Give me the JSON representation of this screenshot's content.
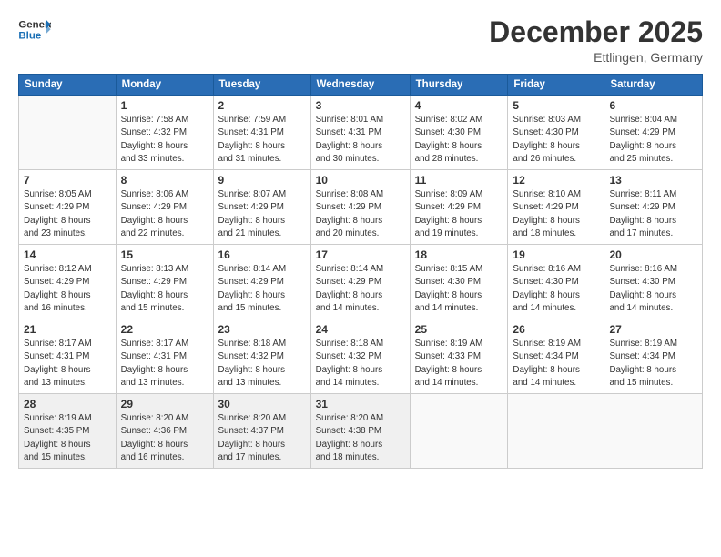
{
  "header": {
    "logo_line1": "General",
    "logo_line2": "Blue",
    "month_title": "December 2025",
    "location": "Ettlingen, Germany"
  },
  "days_of_week": [
    "Sunday",
    "Monday",
    "Tuesday",
    "Wednesday",
    "Thursday",
    "Friday",
    "Saturday"
  ],
  "weeks": [
    [
      {
        "day": "",
        "info": ""
      },
      {
        "day": "1",
        "info": "Sunrise: 7:58 AM\nSunset: 4:32 PM\nDaylight: 8 hours\nand 33 minutes."
      },
      {
        "day": "2",
        "info": "Sunrise: 7:59 AM\nSunset: 4:31 PM\nDaylight: 8 hours\nand 31 minutes."
      },
      {
        "day": "3",
        "info": "Sunrise: 8:01 AM\nSunset: 4:31 PM\nDaylight: 8 hours\nand 30 minutes."
      },
      {
        "day": "4",
        "info": "Sunrise: 8:02 AM\nSunset: 4:30 PM\nDaylight: 8 hours\nand 28 minutes."
      },
      {
        "day": "5",
        "info": "Sunrise: 8:03 AM\nSunset: 4:30 PM\nDaylight: 8 hours\nand 26 minutes."
      },
      {
        "day": "6",
        "info": "Sunrise: 8:04 AM\nSunset: 4:29 PM\nDaylight: 8 hours\nand 25 minutes."
      }
    ],
    [
      {
        "day": "7",
        "info": "Sunrise: 8:05 AM\nSunset: 4:29 PM\nDaylight: 8 hours\nand 23 minutes."
      },
      {
        "day": "8",
        "info": "Sunrise: 8:06 AM\nSunset: 4:29 PM\nDaylight: 8 hours\nand 22 minutes."
      },
      {
        "day": "9",
        "info": "Sunrise: 8:07 AM\nSunset: 4:29 PM\nDaylight: 8 hours\nand 21 minutes."
      },
      {
        "day": "10",
        "info": "Sunrise: 8:08 AM\nSunset: 4:29 PM\nDaylight: 8 hours\nand 20 minutes."
      },
      {
        "day": "11",
        "info": "Sunrise: 8:09 AM\nSunset: 4:29 PM\nDaylight: 8 hours\nand 19 minutes."
      },
      {
        "day": "12",
        "info": "Sunrise: 8:10 AM\nSunset: 4:29 PM\nDaylight: 8 hours\nand 18 minutes."
      },
      {
        "day": "13",
        "info": "Sunrise: 8:11 AM\nSunset: 4:29 PM\nDaylight: 8 hours\nand 17 minutes."
      }
    ],
    [
      {
        "day": "14",
        "info": "Sunrise: 8:12 AM\nSunset: 4:29 PM\nDaylight: 8 hours\nand 16 minutes."
      },
      {
        "day": "15",
        "info": "Sunrise: 8:13 AM\nSunset: 4:29 PM\nDaylight: 8 hours\nand 15 minutes."
      },
      {
        "day": "16",
        "info": "Sunrise: 8:14 AM\nSunset: 4:29 PM\nDaylight: 8 hours\nand 15 minutes."
      },
      {
        "day": "17",
        "info": "Sunrise: 8:14 AM\nSunset: 4:29 PM\nDaylight: 8 hours\nand 14 minutes."
      },
      {
        "day": "18",
        "info": "Sunrise: 8:15 AM\nSunset: 4:30 PM\nDaylight: 8 hours\nand 14 minutes."
      },
      {
        "day": "19",
        "info": "Sunrise: 8:16 AM\nSunset: 4:30 PM\nDaylight: 8 hours\nand 14 minutes."
      },
      {
        "day": "20",
        "info": "Sunrise: 8:16 AM\nSunset: 4:30 PM\nDaylight: 8 hours\nand 14 minutes."
      }
    ],
    [
      {
        "day": "21",
        "info": "Sunrise: 8:17 AM\nSunset: 4:31 PM\nDaylight: 8 hours\nand 13 minutes."
      },
      {
        "day": "22",
        "info": "Sunrise: 8:17 AM\nSunset: 4:31 PM\nDaylight: 8 hours\nand 13 minutes."
      },
      {
        "day": "23",
        "info": "Sunrise: 8:18 AM\nSunset: 4:32 PM\nDaylight: 8 hours\nand 13 minutes."
      },
      {
        "day": "24",
        "info": "Sunrise: 8:18 AM\nSunset: 4:32 PM\nDaylight: 8 hours\nand 14 minutes."
      },
      {
        "day": "25",
        "info": "Sunrise: 8:19 AM\nSunset: 4:33 PM\nDaylight: 8 hours\nand 14 minutes."
      },
      {
        "day": "26",
        "info": "Sunrise: 8:19 AM\nSunset: 4:34 PM\nDaylight: 8 hours\nand 14 minutes."
      },
      {
        "day": "27",
        "info": "Sunrise: 8:19 AM\nSunset: 4:34 PM\nDaylight: 8 hours\nand 15 minutes."
      }
    ],
    [
      {
        "day": "28",
        "info": "Sunrise: 8:19 AM\nSunset: 4:35 PM\nDaylight: 8 hours\nand 15 minutes."
      },
      {
        "day": "29",
        "info": "Sunrise: 8:20 AM\nSunset: 4:36 PM\nDaylight: 8 hours\nand 16 minutes."
      },
      {
        "day": "30",
        "info": "Sunrise: 8:20 AM\nSunset: 4:37 PM\nDaylight: 8 hours\nand 17 minutes."
      },
      {
        "day": "31",
        "info": "Sunrise: 8:20 AM\nSunset: 4:38 PM\nDaylight: 8 hours\nand 18 minutes."
      },
      {
        "day": "",
        "info": ""
      },
      {
        "day": "",
        "info": ""
      },
      {
        "day": "",
        "info": ""
      }
    ]
  ]
}
